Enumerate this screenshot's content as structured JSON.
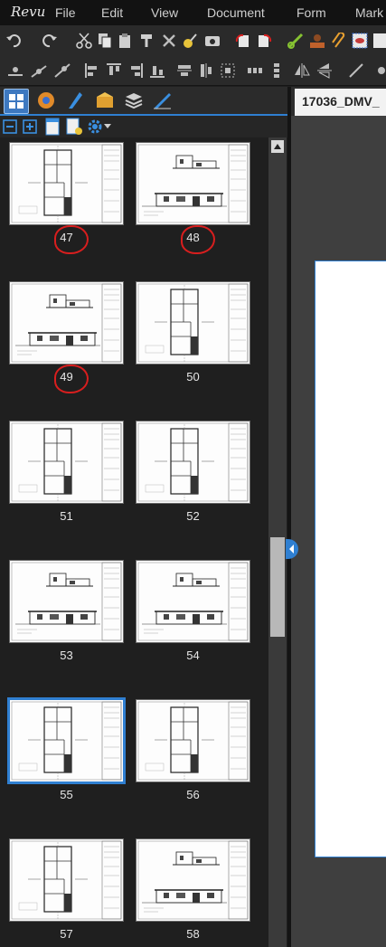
{
  "app": {
    "logo": "Revu"
  },
  "menu": [
    "File",
    "Edit",
    "View",
    "Document",
    "Form",
    "Mark"
  ],
  "document": {
    "tab_title": "17036_DMV_"
  },
  "thumbnails": [
    {
      "page": "47",
      "layout": "plan",
      "marked": true,
      "selected": false
    },
    {
      "page": "48",
      "layout": "elevation",
      "marked": true,
      "selected": false
    },
    {
      "page": "49",
      "layout": "elevation",
      "marked": true,
      "selected": false
    },
    {
      "page": "50",
      "layout": "plan",
      "marked": false,
      "selected": false
    },
    {
      "page": "51",
      "layout": "plan",
      "marked": false,
      "selected": false
    },
    {
      "page": "52",
      "layout": "plan",
      "marked": false,
      "selected": false
    },
    {
      "page": "53",
      "layout": "elevation",
      "marked": false,
      "selected": false
    },
    {
      "page": "54",
      "layout": "elevation",
      "marked": false,
      "selected": false
    },
    {
      "page": "55",
      "layout": "plan",
      "marked": false,
      "selected": true
    },
    {
      "page": "56",
      "layout": "plan",
      "marked": false,
      "selected": false
    },
    {
      "page": "57",
      "layout": "plan",
      "marked": false,
      "selected": false
    },
    {
      "page": "58",
      "layout": "elevation",
      "marked": false,
      "selected": false
    }
  ],
  "colors": {
    "accent": "#2f7fd1",
    "markup": "#d81e1e"
  }
}
